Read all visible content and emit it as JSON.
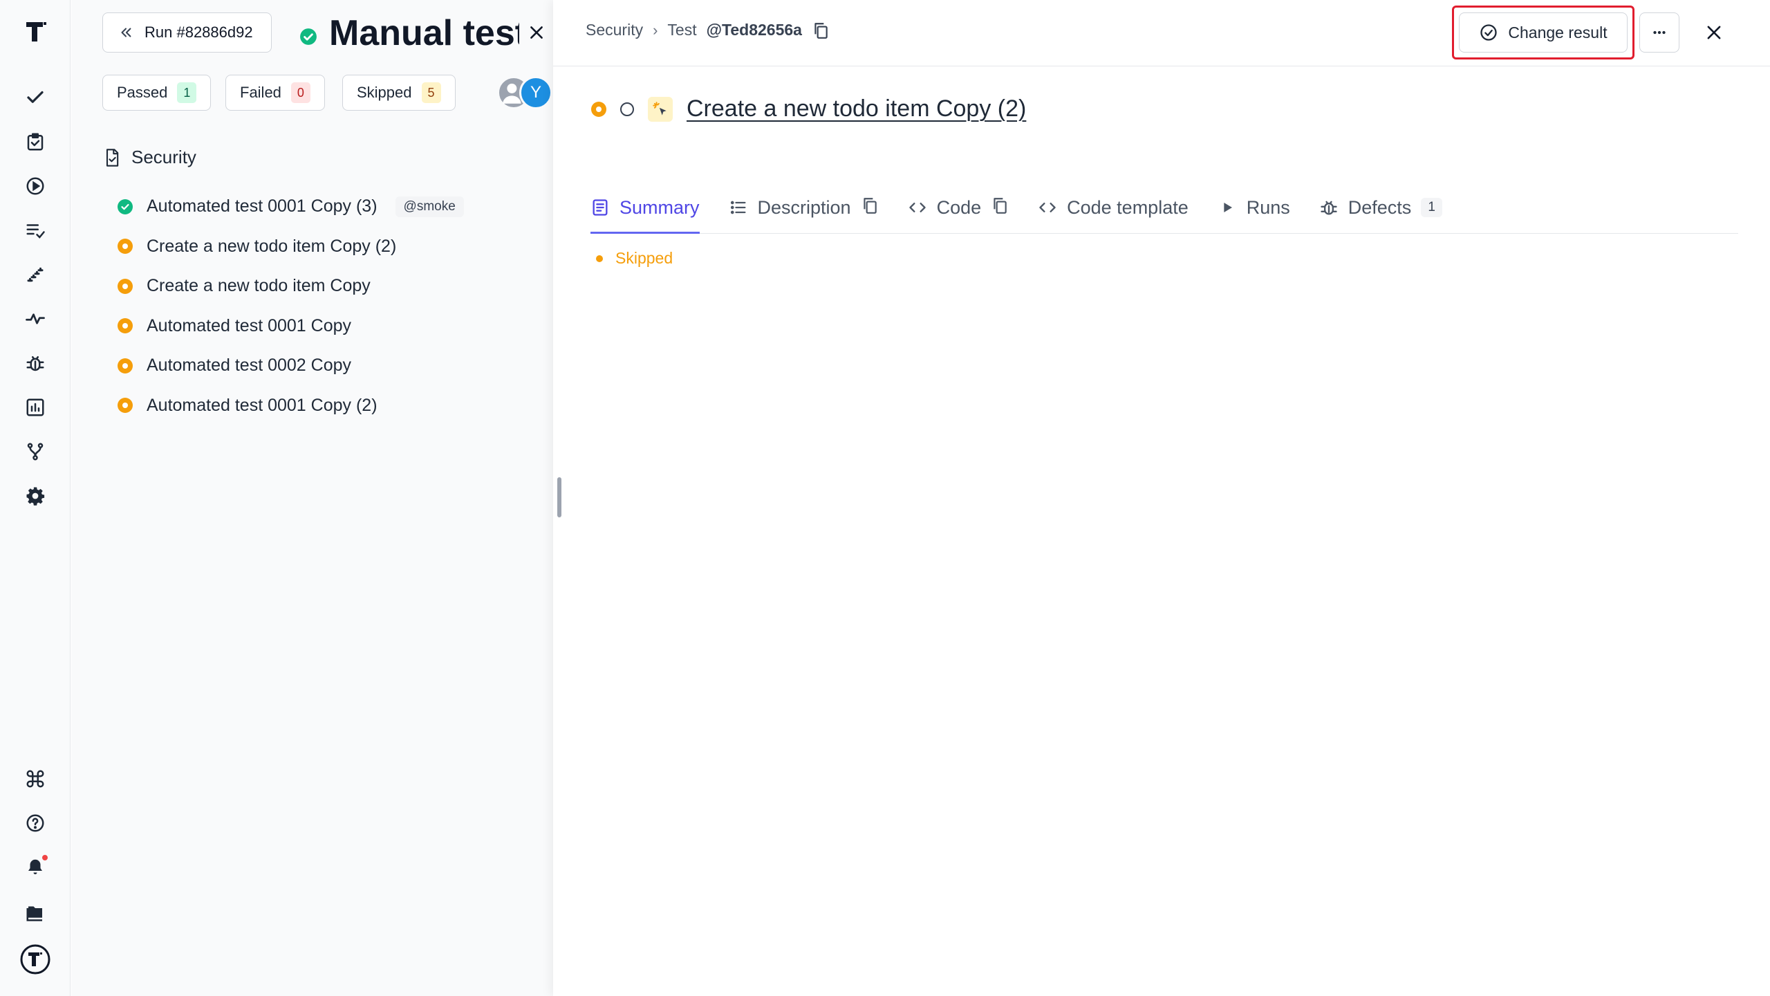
{
  "run": {
    "back_label": "Run #82886d92",
    "title": "Manual test",
    "filters": {
      "passed_label": "Passed",
      "passed_count": "1",
      "failed_label": "Failed",
      "failed_count": "0",
      "skipped_label": "Skipped",
      "skipped_count": "5"
    },
    "avatar_initial": "Y",
    "suite_name": "Security",
    "tests": [
      {
        "name": "Automated test 0001 Copy (3)",
        "status": "passed",
        "tag": "@smoke"
      },
      {
        "name": "Create a new todo item Copy (2)",
        "status": "skipped"
      },
      {
        "name": "Create a new todo item Copy",
        "status": "skipped"
      },
      {
        "name": "Automated test 0001 Copy",
        "status": "skipped"
      },
      {
        "name": "Automated test 0002 Copy",
        "status": "skipped"
      },
      {
        "name": "Automated test 0001 Copy (2)",
        "status": "skipped"
      }
    ]
  },
  "detail": {
    "breadcrumb": {
      "suite": "Security",
      "sep": "›",
      "prefix": "Test",
      "id": "@Ted82656a"
    },
    "change_result_label": "Change result",
    "test_title": "Create a new todo item Copy (2)",
    "tabs": [
      {
        "label": "Summary"
      },
      {
        "label": "Description"
      },
      {
        "label": "Code"
      },
      {
        "label": "Code template"
      },
      {
        "label": "Runs"
      },
      {
        "label": "Defects",
        "count": "1"
      }
    ],
    "summary_status": "Skipped"
  },
  "colors": {
    "passed": "#10b981",
    "skipped": "#f59e0b",
    "accent": "#4f46e5",
    "highlight": "#e11d2e"
  },
  "icons": [
    "logo-icon",
    "check-icon",
    "clipboard-icon",
    "play-circle-icon",
    "list-check-icon",
    "steps-icon",
    "pulse-icon",
    "bug-icon",
    "chart-icon",
    "branch-icon",
    "gear-icon",
    "command-icon",
    "help-icon",
    "bell-icon",
    "folders-icon",
    "brand-icon"
  ]
}
